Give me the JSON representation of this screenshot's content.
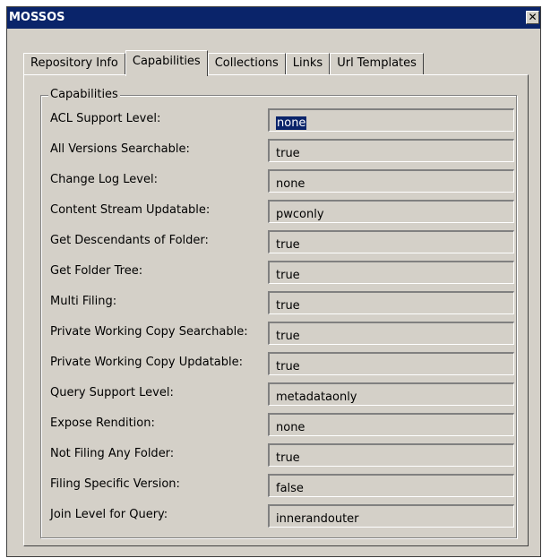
{
  "window": {
    "title": "MOSSOS",
    "close_glyph": "✕"
  },
  "tabs": [
    {
      "label": "Repository Info",
      "active": false
    },
    {
      "label": "Capabilities",
      "active": true
    },
    {
      "label": "Collections",
      "active": false
    },
    {
      "label": "Links",
      "active": false
    },
    {
      "label": "Url Templates",
      "active": false
    }
  ],
  "capabilities": {
    "group_title": "Capabilities",
    "rows": [
      {
        "label": "ACL Support Level:",
        "value": "none",
        "selected": true
      },
      {
        "label": "All Versions Searchable:",
        "value": "true"
      },
      {
        "label": "Change Log Level:",
        "value": "none"
      },
      {
        "label": "Content Stream Updatable:",
        "value": "pwconly"
      },
      {
        "label": "Get Descendants of Folder:",
        "value": "true"
      },
      {
        "label": "Get Folder Tree:",
        "value": "true"
      },
      {
        "label": "Multi Filing:",
        "value": "true"
      },
      {
        "label": "Private Working Copy Searchable:",
        "value": "true"
      },
      {
        "label": "Private Working Copy Updatable:",
        "value": "true"
      },
      {
        "label": "Query Support Level:",
        "value": "metadataonly"
      },
      {
        "label": "Expose Rendition:",
        "value": "none"
      },
      {
        "label": "Not Filing Any Folder:",
        "value": "true"
      },
      {
        "label": "Filing Specific Version:",
        "value": "false"
      },
      {
        "label": "Join Level for Query:",
        "value": "innerandouter"
      }
    ]
  },
  "colors": {
    "titlebar": "#0a246a",
    "face": "#d4d0c8",
    "selection": "#0a246a"
  }
}
